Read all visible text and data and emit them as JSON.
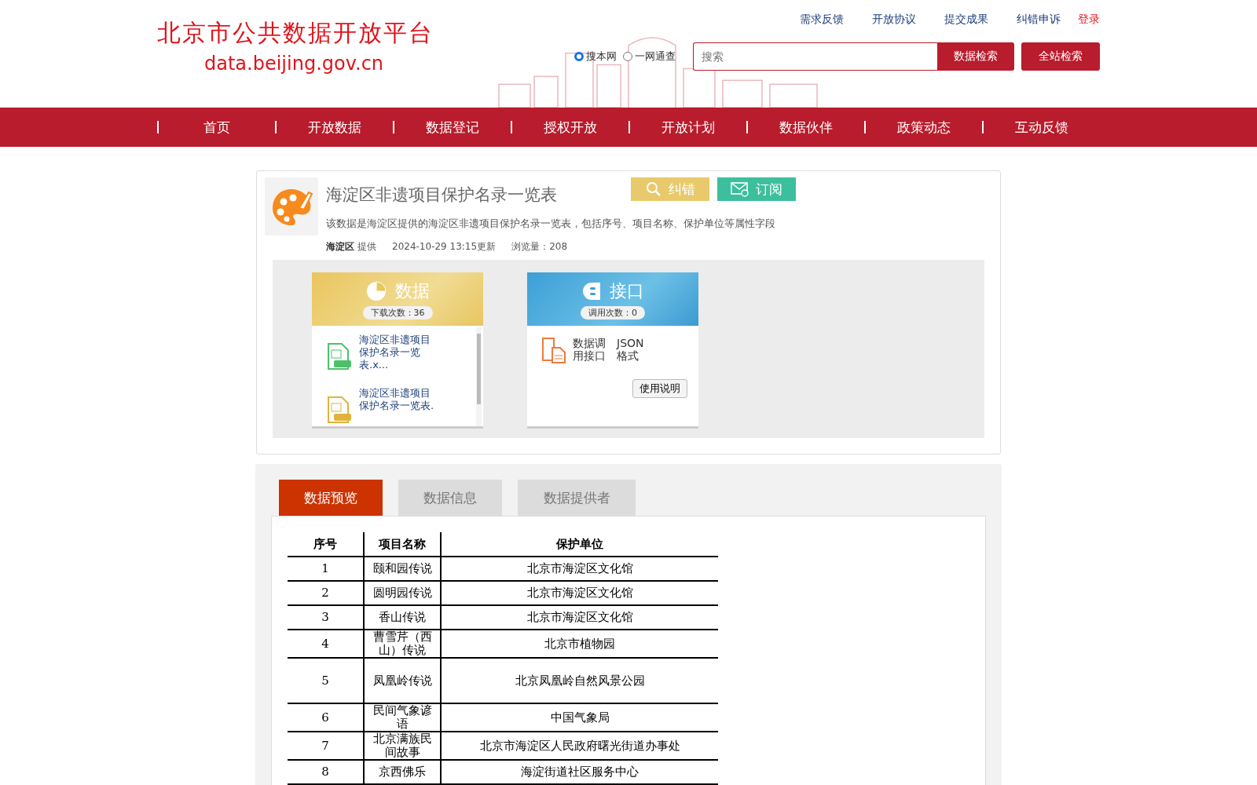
{
  "header": {
    "logo_title": "北京市公共数据开放平台",
    "logo_url": "data.beijing.gov.cn",
    "top_links": [
      {
        "label": "需求反馈",
        "kind": "link"
      },
      {
        "label": "开放协议",
        "kind": "link"
      },
      {
        "label": "提交成果",
        "kind": "link"
      },
      {
        "label": "纠错申诉",
        "kind": "link"
      },
      {
        "label": "登录",
        "kind": "login"
      }
    ],
    "search_scope": [
      {
        "label": "搜本网",
        "selected": true
      },
      {
        "label": "一网通查",
        "selected": false
      }
    ],
    "search": {
      "placeholder": "搜索"
    },
    "search_buttons": [
      "数据检索",
      "全站检索"
    ]
  },
  "nav": [
    "首页",
    "开放数据",
    "数据登记",
    "授权开放",
    "开放计划",
    "数据伙伴",
    "政策动态",
    "互动反馈"
  ],
  "dataset": {
    "title": "海淀区非遗项目保护名录一览表",
    "actions": [
      {
        "label": "纠错",
        "kind": "correct"
      },
      {
        "label": "订阅",
        "kind": "subscribe"
      }
    ],
    "description": "该数据是海淀区提供的海淀区非遗项目保护名录一览表，包括序号、项目名称、保护单位等属性字段",
    "provider": "海淀区",
    "provider_suffix": "提供",
    "updated": "2024-10-29 13:15更新",
    "views": "浏览量：208",
    "data_panel": {
      "title": "数据",
      "count": "下载次数：36",
      "files": [
        {
          "name": "海淀区非遗项目保护名录一览表.x...",
          "kind": "xls"
        },
        {
          "name": "海淀区非遗项目保护名录一览表.",
          "kind": "csv"
        }
      ]
    },
    "api_panel": {
      "title": "接口",
      "count": "调用次数：0",
      "label": "数据调用接口",
      "format": "JSON格式",
      "button": "使用说明"
    }
  },
  "tabs": [
    {
      "label": "数据预览",
      "selected": true
    },
    {
      "label": "数据信息",
      "selected": false
    },
    {
      "label": "数据提供者",
      "selected": false
    }
  ],
  "table": {
    "columns": [
      "序号",
      "项目名称",
      "保护单位"
    ],
    "rows": [
      [
        "1",
        "颐和园传说",
        "北京市海淀区文化馆"
      ],
      [
        "2",
        "圆明园传说",
        "北京市海淀区文化馆"
      ],
      [
        "3",
        "香山传说",
        "北京市海淀区文化馆"
      ],
      [
        "4",
        "曹雪芹（西山）传说",
        "北京市植物园"
      ],
      [
        "5",
        "凤凰岭传说",
        "北京凤凰岭自然风景公园"
      ],
      [
        "6",
        "民间气象谚语",
        "中国气象局"
      ],
      [
        "7",
        "北京满族民间故事",
        "北京市海淀区人民政府曙光街道办事处"
      ],
      [
        "8",
        "京西佛乐",
        "海淀街道社区服务中心"
      ]
    ]
  }
}
